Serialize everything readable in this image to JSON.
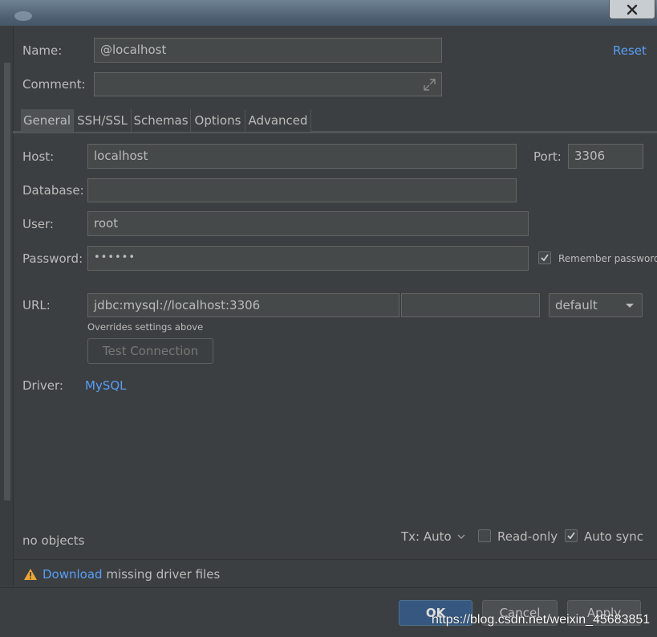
{
  "window": {
    "close_icon": "close-icon"
  },
  "header": {
    "name_label": "Name:",
    "name_value": "@localhost",
    "comment_label": "Comment:",
    "comment_value": "",
    "reset_link": "Reset"
  },
  "tabs": [
    {
      "label": "General",
      "selected": true
    },
    {
      "label": "SSH/SSL",
      "selected": false
    },
    {
      "label": "Schemas",
      "selected": false
    },
    {
      "label": "Options",
      "selected": false
    },
    {
      "label": "Advanced",
      "selected": false
    }
  ],
  "general": {
    "host_label": "Host:",
    "host_value": "localhost",
    "port_label": "Port:",
    "port_value": "3306",
    "database_label": "Database:",
    "database_value": "",
    "user_label": "User:",
    "user_value": "root",
    "password_label": "Password:",
    "password_value": "••••••",
    "remember_password_label": "Remember password",
    "remember_password_checked": true,
    "url_label": "URL:",
    "url_value": "jdbc:mysql://localhost:3306",
    "url_extra_value": "",
    "url_mode": "default",
    "url_hint": "Overrides settings above",
    "test_connection_label": "Test Connection",
    "driver_label": "Driver:",
    "driver_value": "MySQL"
  },
  "status": {
    "objects_text": "no objects",
    "tx_label": "Tx: Auto",
    "read_only_label": "Read-only",
    "read_only_checked": false,
    "auto_sync_label": "Auto sync",
    "auto_sync_checked": true
  },
  "warning": {
    "link_text": "Download",
    "message": " missing driver files"
  },
  "footer": {
    "ok_label": "OK",
    "cancel_label": "Cancel",
    "apply_label": "Apply",
    "watermark": "https://blog.csdn.net/weixin_45683851"
  },
  "colors": {
    "background": "#3c3f41",
    "field": "#45494a",
    "link": "#589df6",
    "primary_button": "#365880",
    "warning": "#f0a732"
  }
}
